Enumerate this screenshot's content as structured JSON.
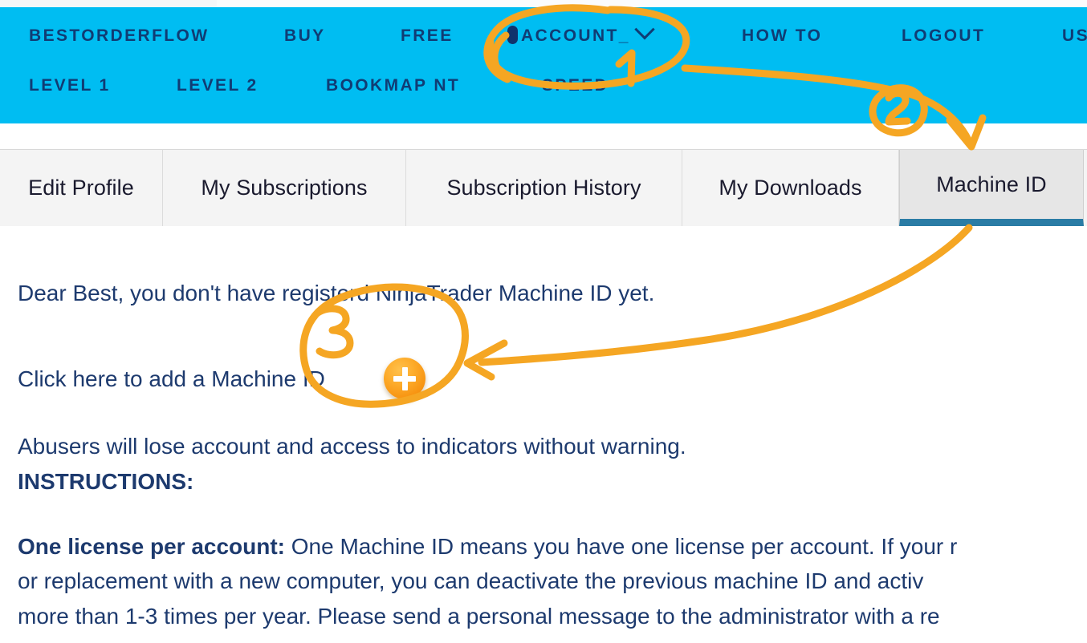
{
  "site": {
    "brand": "BESTORDERFLOW",
    "accent_cyan": "#00bdf2",
    "nav_text_color": "#103c74",
    "annotation_color": "#f5a623",
    "active_tab_underline": "#2a7ca5",
    "body_text_color": "#1d3a6e"
  },
  "nav": {
    "row1": [
      {
        "label": "BESTORDERFLOW",
        "name": "nav-bestorderflow"
      },
      {
        "label": "BUY",
        "name": "nav-buy"
      },
      {
        "label": "FREE",
        "name": "nav-free"
      },
      {
        "label": "ACCOUNT_",
        "name": "nav-account"
      },
      {
        "label": "HOW TO",
        "name": "nav-how-to"
      },
      {
        "label": "LOGOUT",
        "name": "nav-logout"
      },
      {
        "label": "US",
        "name": "nav-us-truncated"
      }
    ],
    "row2": [
      {
        "label": "LEVEL 1",
        "name": "nav-level-1"
      },
      {
        "label": "LEVEL 2",
        "name": "nav-level-2"
      },
      {
        "label": "BOOKMAP NT",
        "name": "nav-bookmap-nt"
      },
      {
        "label": "SPEED",
        "name": "nav-speed"
      }
    ]
  },
  "tabs": [
    {
      "label": "Edit Profile",
      "active": false
    },
    {
      "label": "My Subscriptions",
      "active": false
    },
    {
      "label": "Subscription History",
      "active": false
    },
    {
      "label": "My Downloads",
      "active": false
    },
    {
      "label": "Machine ID",
      "active": true
    }
  ],
  "content": {
    "greeting": "Dear Best, you don't have registerd NinjaTrader Machine ID yet.",
    "add_machine_id": "Click here to add a Machine ID",
    "warning": "Abusers will lose account and access to indicators without warning.",
    "instructions_heading": "INSTRUCTIONS:",
    "license_heading": "One license per account:",
    "license_line1": " One Machine ID means you have one license per account. If your r",
    "license_line2": "or replacement with a new computer, you can deactivate the previous machine ID and activ",
    "license_line3": "more than 1-3 times per year. Please send a personal message to the administrator with a re"
  },
  "annotations": [
    {
      "number": "1",
      "target": "ACCOUNT_ menu in navigation bar"
    },
    {
      "number": "2",
      "target": "Machine ID tab"
    },
    {
      "number": "3",
      "target": "Orange plus button to add a Machine ID"
    }
  ]
}
